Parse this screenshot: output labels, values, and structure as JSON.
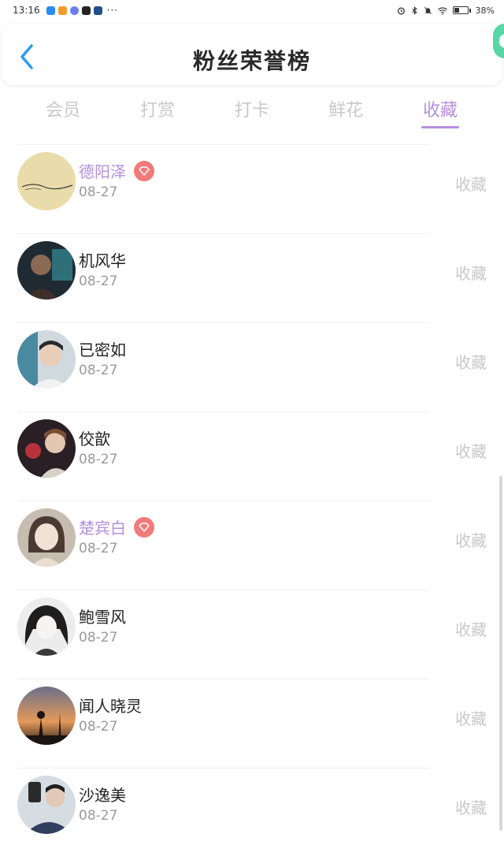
{
  "status_bar": {
    "time": "13:16",
    "more": "···",
    "battery_percent": "38%",
    "battery_level": 0.38,
    "app_icon_colors": [
      "#2b8cf2",
      "#f39a2b",
      "#6c7cf0",
      "#222222",
      "#1f4e8c"
    ]
  },
  "header": {
    "title": "粉丝荣誉榜"
  },
  "tabs": [
    {
      "label": "会员",
      "active": false
    },
    {
      "label": "打赏",
      "active": false
    },
    {
      "label": "打卡",
      "active": false
    },
    {
      "label": "鲜花",
      "active": false
    },
    {
      "label": "收藏",
      "active": true
    }
  ],
  "colors": {
    "accent": "#b48fdc",
    "back_arrow": "#2a9df4",
    "vip_badge": "#f27a7a",
    "muted": "#c8c8c8"
  },
  "fans": [
    {
      "name": "德阳泽",
      "date": "08-27",
      "action": "收藏",
      "vip": true
    },
    {
      "name": "机风华",
      "date": "08-27",
      "action": "收藏",
      "vip": false
    },
    {
      "name": "已密如",
      "date": "08-27",
      "action": "收藏",
      "vip": false
    },
    {
      "name": "佼歆",
      "date": "08-27",
      "action": "收藏",
      "vip": false
    },
    {
      "name": "楚宾白",
      "date": "08-27",
      "action": "收藏",
      "vip": true
    },
    {
      "name": "鲍雪风",
      "date": "08-27",
      "action": "收藏",
      "vip": false
    },
    {
      "name": "闻人晓灵",
      "date": "08-27",
      "action": "收藏",
      "vip": false
    },
    {
      "name": "沙逸美",
      "date": "08-27",
      "action": "收藏",
      "vip": false
    }
  ]
}
